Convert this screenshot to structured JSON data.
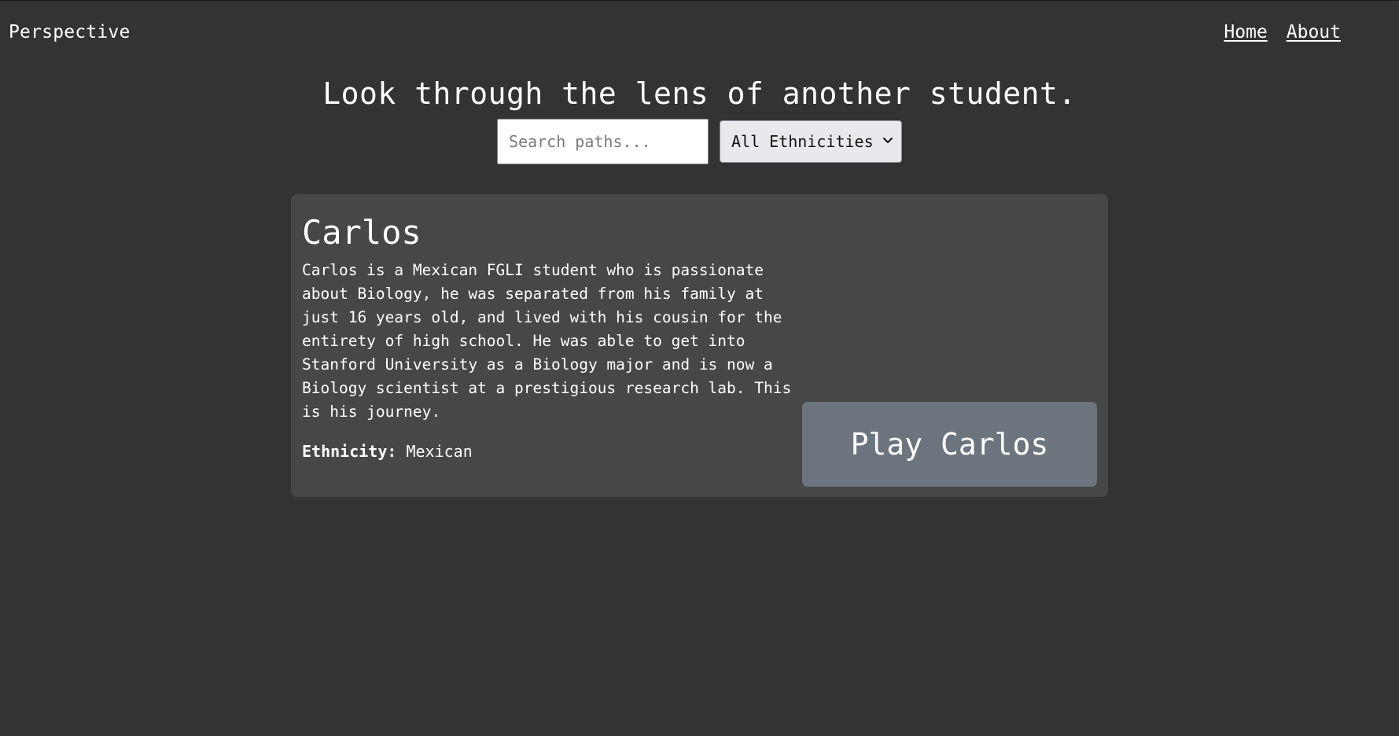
{
  "header": {
    "brand": "Perspective",
    "nav": [
      {
        "label": "Home"
      },
      {
        "label": "About"
      }
    ]
  },
  "hero": {
    "title": "Look through the lens of another student."
  },
  "filters": {
    "search_placeholder": "Search paths...",
    "search_value": "",
    "ethnicity_selected": "All Ethnicities"
  },
  "cards": [
    {
      "name": "Carlos",
      "description": "Carlos is a Mexican FGLI student who is passionate about Biology, he was separated from his family at just 16 years old, and lived with his cousin for the entirety of high school. He was able to get into Stanford University as a Biology major and is now a Biology scientist at a prestigious research lab. This is his journey.",
      "ethnicity_label": "Ethnicity:",
      "ethnicity_value": "Mexican",
      "play_label": "Play Carlos"
    }
  ],
  "colors": {
    "background": "#333333",
    "card": "#474747",
    "play_button": "#6c757d",
    "select_bg": "#e9e9ed"
  },
  "icons": {
    "select_arrow": "chevron-down-icon"
  }
}
